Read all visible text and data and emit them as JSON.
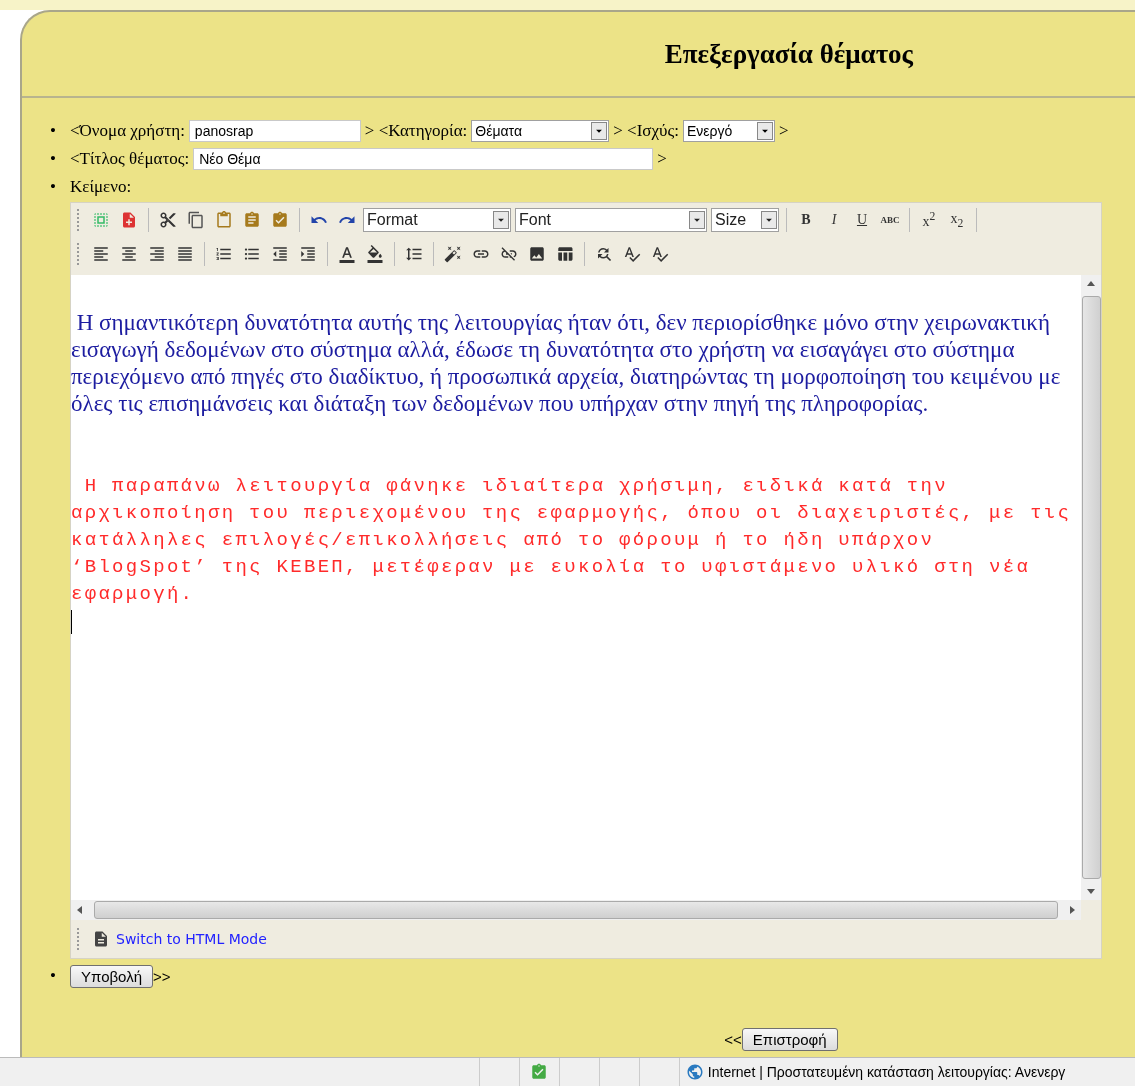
{
  "page_title": "Επεξεργασία θέματος",
  "bullets": [
    "•",
    "•",
    "•",
    "•"
  ],
  "form": {
    "user_label": "<Όνομα χρήστη:",
    "user_value": "panosrap",
    "category_label": "> <Κατηγορία:",
    "category_value": "Θέματα",
    "validity_label": "> <Ισχύς:",
    "validity_value": "Ενεργό",
    "line1_end": ">",
    "title_label": "<Τίτλος θέματος:",
    "title_value": "Νέο Θέμα",
    "line2_end": ">",
    "text_label": "Κείμενο:"
  },
  "toolbar": {
    "row_1": [
      {
        "kind": "icon"
      },
      {
        "kind": "icon"
      },
      {
        "kind": "sep"
      },
      {
        "kind": "icon"
      },
      {
        "kind": "icon"
      },
      {
        "kind": "icon"
      },
      {
        "kind": "icon"
      },
      {
        "kind": "icon"
      },
      {
        "kind": "sep"
      },
      {
        "kind": "icon"
      },
      {
        "kind": "icon"
      },
      {
        "kind": "select",
        "label": "Format"
      },
      {
        "kind": "select",
        "label": "Font"
      },
      {
        "kind": "select",
        "label": "Size"
      },
      {
        "kind": "sep"
      },
      {
        "kind": "text",
        "label": "B"
      },
      {
        "kind": "text",
        "label": "I"
      },
      {
        "kind": "text",
        "label": "U"
      },
      {
        "kind": "text",
        "label": "ABC"
      },
      {
        "kind": "sep"
      },
      {
        "kind": "text",
        "label": "x$^{2}$"
      },
      {
        "kind": "text",
        "label": "x$_{2}$"
      },
      {
        "kind": "sep"
      }
    ],
    "row_2": [
      {
        "kind": "icon"
      },
      {
        "kind": "icon"
      },
      {
        "kind": "icon"
      },
      {
        "kind": "icon"
      },
      {
        "kind": "sep"
      },
      {
        "kind": "icon"
      },
      {
        "kind": "icon"
      },
      {
        "kind": "icon"
      },
      {
        "kind": "icon"
      },
      {
        "kind": "sep"
      },
      {
        "kind": "icon"
      },
      {
        "kind": "icon"
      },
      {
        "kind": "sep"
      },
      {
        "kind": "icon"
      },
      {
        "kind": "sep"
      },
      {
        "kind": "icon"
      },
      {
        "kind": "icon"
      },
      {
        "kind": "icon"
      },
      {
        "kind": "icon"
      },
      {
        "kind": "icon"
      },
      {
        "kind": "sep"
      },
      {
        "kind": "icon"
      },
      {
        "kind": "icon"
      },
      {
        "kind": "icon"
      }
    ]
  },
  "content": [
    {
      "kind": "serif",
      "color": "#1c1ca0",
      "text": " Η σημαντικότερη δυνατότητα αυτής της λειτουργίας ήταν ότι, δεν περιορίσθηκε μόνο στην χειρωνακτική εισαγωγή δεδομένων στο σύστημα αλλά, έδωσε τη δυνατότητα στο χρήστη να εισαγάγει στο σύστημα περιεχόμενο από πηγές στο διαδίκτυο, ή προσωπικά αρχεία, διατηρώντας τη μορφοποίηση του κειμένου με όλες τις επισημάνσεις και διάταξη των δεδομένων που υπήρχαν στην πηγή της πληροφορίας."
    },
    {
      "kind": "mono",
      "color": "#ff2a2a",
      "text": " Η παραπάνω λειτουργία φάνηκε ιδιαίτερα χρήσιμη, ειδικά κατά την αρχικοποίηση του περιεχομένου της εφαρμογής, όπου οι διαχειριστές, με τις κατάλληλες επιλογές/επικολλήσεις από το φόρουμ ή το ήδη υπάρχον ‘BlogSpot’ της ΚΕΒΕΠ, μετέφεραν με ευκολία το υφιστάμενο υλικό στη νέα εφαρμογή."
    }
  ],
  "editor_footer": {
    "mode_link": "Switch to HTML Mode"
  },
  "submit": {
    "label": "Υποβολή",
    "suffix": ">>"
  },
  "back": {
    "prefix": "<<",
    "label": "Επιστροφή"
  },
  "status_bar": {
    "text": "Internet | Προστατευμένη κατάσταση λειτουργίας: Ανενεργ"
  }
}
